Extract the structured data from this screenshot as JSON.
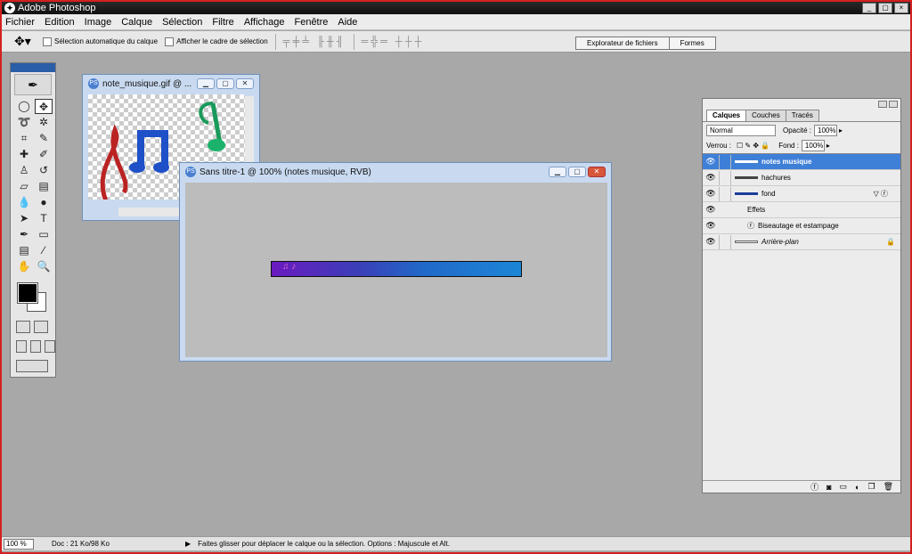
{
  "app": {
    "title": "Adobe Photoshop",
    "icon_letter": "Ps",
    "window_controls": [
      "_",
      "▢",
      "×"
    ]
  },
  "menu": [
    "Fichier",
    "Edition",
    "Image",
    "Calque",
    "Sélection",
    "Filtre",
    "Affichage",
    "Fenêtre",
    "Aide"
  ],
  "options_bar": {
    "auto_select_label": "Sélection automatique du calque",
    "show_bounds_label": "Afficher le cadre de sélection",
    "dock_tabs": [
      "Explorateur de fichiers",
      "Formes"
    ]
  },
  "doc_windows": [
    {
      "title": "note_musique.gif @ ..."
    },
    {
      "title": "Sans titre-1 @ 100% (notes musique, RVB)"
    }
  ],
  "layers_panel": {
    "tabs": [
      "Calques",
      "Couches",
      "Tracés"
    ],
    "blend_mode": "Normal",
    "opacity_label": "Opacité :",
    "opacity_value": "100%",
    "lock_label": "Verrou :",
    "fill_label": "Fond :",
    "fill_value": "100%",
    "layers": [
      {
        "name": "notes musique",
        "selected": true
      },
      {
        "name": "hachures",
        "selected": false
      },
      {
        "name": "fond",
        "selected": false,
        "has_effects": true
      }
    ],
    "effects_label": "Effets",
    "effect_name": "Biseautage et estampage",
    "background_layer": "Arrière-plan"
  },
  "status": {
    "zoom": "100 %",
    "doc_info": "Doc : 21 Ko/98 Ko",
    "message": "Faites glisser pour déplacer le calque ou la sélection. Options : Majuscule et Alt."
  },
  "colors": {
    "selected_layer": "#3e7fd8",
    "frame": "#d42020"
  }
}
